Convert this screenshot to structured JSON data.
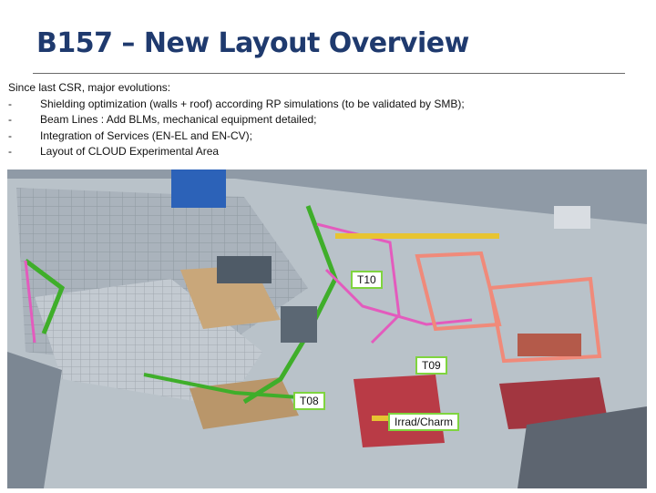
{
  "title": "B157 – New Layout Overview",
  "intro": {
    "heading": "Since last CSR, major evolutions:",
    "bullets": [
      "Shielding optimization (walls + roof) according RP simulations (to be validated by SMB);",
      "Beam Lines : Add BLMs, mechanical equipment detailed;",
      "Integration of Services (EN-EL and EN-CV);",
      "Layout of CLOUD Experimental Area"
    ],
    "bullet_marker": "-"
  },
  "figure": {
    "labels": {
      "t10": "T10",
      "t09": "T09",
      "t08": "T08",
      "irrad": "Irrad/Charm"
    },
    "colors": {
      "floor": "#b9c2c9",
      "shielding": "#a9b1ba",
      "shielding_dark": "#8a939c",
      "beam_green": "#3fae2a",
      "beam_magenta": "#e35bbd",
      "salmon": "#f08a7a",
      "wall_red": "#b8232f",
      "accent_yellow": "#e7c431",
      "accent_blue": "#2c62b8",
      "tan": "#c9a77a",
      "label_border": "#7fd43f"
    }
  }
}
